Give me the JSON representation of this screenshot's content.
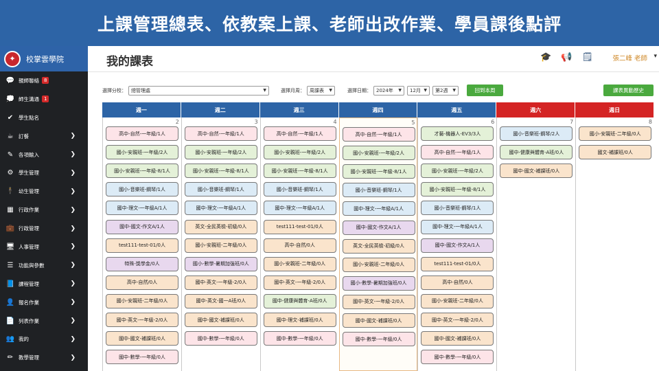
{
  "banner": {
    "title": "上課管理總表、依教案上課、老師出改作業、學員課後點評"
  },
  "brand": {
    "name": "校掌雲學院",
    "logo_icon": "shield-logo-icon"
  },
  "sidebar": {
    "items": [
      {
        "label": "親師聯絡",
        "icon": "chat-icon",
        "glyph": "💬",
        "badge": "8",
        "chevron": false
      },
      {
        "label": "師生溝通",
        "icon": "comment-icon",
        "glyph": "💭",
        "badge": "1",
        "chevron": false
      },
      {
        "label": "學生點名",
        "icon": "check-icon",
        "glyph": "✔",
        "badge": null,
        "chevron": false
      },
      {
        "label": "訂餐",
        "icon": "coffee-icon",
        "glyph": "☕",
        "badge": null,
        "chevron": true
      },
      {
        "label": "各項輸入",
        "icon": "edit-icon",
        "glyph": "✎",
        "badge": null,
        "chevron": true
      },
      {
        "label": "學生管理",
        "icon": "cogs-icon",
        "glyph": "⚙",
        "badge": null,
        "chevron": true
      },
      {
        "label": "幼生管理",
        "icon": "child-icon",
        "glyph": "🕴",
        "badge": null,
        "chevron": true
      },
      {
        "label": "行政作業",
        "icon": "calendar-icon",
        "glyph": "▦",
        "badge": null,
        "chevron": true
      },
      {
        "label": "行政管理",
        "icon": "briefcase-icon",
        "glyph": "💼",
        "badge": null,
        "chevron": true
      },
      {
        "label": "人事管理",
        "icon": "presentation-icon",
        "glyph": "🖥",
        "badge": null,
        "chevron": true
      },
      {
        "label": "功能與參數",
        "icon": "database-icon",
        "glyph": "☰",
        "badge": null,
        "chevron": true
      },
      {
        "label": "課程管理",
        "icon": "book-icon",
        "glyph": "📘",
        "badge": null,
        "chevron": true
      },
      {
        "label": "報名作業",
        "icon": "user-plus-icon",
        "glyph": "👤",
        "badge": null,
        "chevron": true
      },
      {
        "label": "列表作業",
        "icon": "file-icon",
        "glyph": "📄",
        "badge": null,
        "chevron": true
      },
      {
        "label": "我的",
        "icon": "users-icon",
        "glyph": "👥",
        "badge": null,
        "chevron": true
      },
      {
        "label": "教學管理",
        "icon": "pencil-icon",
        "glyph": "✏",
        "badge": null,
        "chevron": true
      }
    ]
  },
  "header": {
    "title": "我的課表",
    "user": "張二峰 老師",
    "icons": [
      "graduation-cap-icon",
      "megaphone-icon",
      "note-icon"
    ]
  },
  "filters": {
    "branch_label": "選擇分校：",
    "branch_value": "總管理處",
    "view_label": "選擇月周：",
    "view_value": "周課表",
    "date_label": "選擇日期：",
    "year_value": "2024年",
    "month_value": "12月",
    "week_value": "第2週",
    "back_button": "回到本周",
    "history_button": "課表異動歷史"
  },
  "colors": {
    "header_blue": "#2d64a6",
    "weekend_red": "#d42424",
    "item_pink": "#fde4e8",
    "item_green": "#e4f1d8",
    "item_blue": "#dcebf6",
    "item_purple": "#e8d8ee",
    "item_peach": "#fae4cc"
  },
  "week": {
    "days": [
      {
        "label": "週一",
        "num": "2",
        "weekend": false,
        "today": false,
        "items": [
          {
            "text": "高中-自然-一年級/1人",
            "color": "pink"
          },
          {
            "text": "國小-安親班-一年級/2人",
            "color": "green"
          },
          {
            "text": "國小-安親班-一年級-8/1人",
            "color": "green"
          },
          {
            "text": "國小-音樂班-鋼琴/1人",
            "color": "blue"
          },
          {
            "text": "國中-理文-一年級A/1人",
            "color": "blue"
          },
          {
            "text": "國中-國文-作文A/1人",
            "color": "purple"
          },
          {
            "text": "test111-test-01/0人",
            "color": "peach"
          },
          {
            "text": "特殊-獎學金/0人",
            "color": "purple"
          },
          {
            "text": "高中-自然/0人",
            "color": "peach"
          },
          {
            "text": "國小-安親班-二年級/0人",
            "color": "peach"
          },
          {
            "text": "國中-英文-一年級-2/0人",
            "color": "peach"
          },
          {
            "text": "國中-國文-補課班/0人",
            "color": "peach"
          },
          {
            "text": "國中-數學-一年級/0人",
            "color": "pink"
          }
        ]
      },
      {
        "label": "週二",
        "num": "3",
        "weekend": false,
        "today": false,
        "items": [
          {
            "text": "高中-自然-一年級/1人",
            "color": "pink"
          },
          {
            "text": "國小-安親班-一年級/2人",
            "color": "green"
          },
          {
            "text": "國小-安親班-一年級-8/1人",
            "color": "green"
          },
          {
            "text": "國小-音樂班-鋼琴/1人",
            "color": "blue"
          },
          {
            "text": "國中-理文-一年級A/1人",
            "color": "blue"
          },
          {
            "text": "英文-全民英檢-初級/0人",
            "color": "peach"
          },
          {
            "text": "國小-安親班-二年級/0人",
            "color": "peach"
          },
          {
            "text": "國小-數學-暑期加強班/0人",
            "color": "purple"
          },
          {
            "text": "國中-英文-一年級-2/0人",
            "color": "peach"
          },
          {
            "text": "國中-英文-國一A班/0人",
            "color": "peach"
          },
          {
            "text": "國中-國文-補課班/0人",
            "color": "peach"
          },
          {
            "text": "國中-數學-一年級/0人",
            "color": "pink"
          }
        ]
      },
      {
        "label": "週三",
        "num": "4",
        "weekend": false,
        "today": false,
        "items": [
          {
            "text": "高中-自然-一年級/1人",
            "color": "pink"
          },
          {
            "text": "國小-安親班-一年級/2人",
            "color": "green"
          },
          {
            "text": "國小-安親班-一年級-8/1人",
            "color": "green"
          },
          {
            "text": "國小-音樂班-鋼琴/1人",
            "color": "blue"
          },
          {
            "text": "國中-理文-一年級A/1人",
            "color": "blue"
          },
          {
            "text": "test111-test-01/0人",
            "color": "peach"
          },
          {
            "text": "高中-自然/0人",
            "color": "peach"
          },
          {
            "text": "國小-安親班-二年級/0人",
            "color": "peach"
          },
          {
            "text": "國中-英文-一年級-2/0人",
            "color": "peach"
          },
          {
            "text": "國中-健康與體育-A班/0人",
            "color": "green"
          },
          {
            "text": "國中-理文-補課班/0人",
            "color": "peach"
          },
          {
            "text": "國中-數學-一年級/0人",
            "color": "pink"
          }
        ]
      },
      {
        "label": "週四",
        "num": "5",
        "weekend": false,
        "today": true,
        "items": [
          {
            "text": "高中-自然-一年級/1人",
            "color": "pink"
          },
          {
            "text": "國小-安親班-一年級/2人",
            "color": "green"
          },
          {
            "text": "國小-安親班-一年級-8/1人",
            "color": "green"
          },
          {
            "text": "國小-音樂班-鋼琴/1人",
            "color": "blue"
          },
          {
            "text": "國中-理文-一年級A/1人",
            "color": "blue"
          },
          {
            "text": "國中-國文-作文A/1人",
            "color": "purple"
          },
          {
            "text": "英文-全民英檢-初級/0人",
            "color": "peach"
          },
          {
            "text": "國小-安親班-二年級/0人",
            "color": "peach"
          },
          {
            "text": "國小-數學-暑期加強班/0人",
            "color": "purple"
          },
          {
            "text": "國中-英文-一年級-2/0人",
            "color": "peach"
          },
          {
            "text": "國中-國文-補課班/0人",
            "color": "peach"
          },
          {
            "text": "國中-數學-一年級/0人",
            "color": "pink"
          }
        ]
      },
      {
        "label": "週五",
        "num": "6",
        "weekend": false,
        "today": false,
        "items": [
          {
            "text": "才藝-機器人-EV3/3人",
            "color": "green"
          },
          {
            "text": "高中-自然-一年級/1人",
            "color": "pink"
          },
          {
            "text": "國小-安親班-一年級/2人",
            "color": "green"
          },
          {
            "text": "國小-安親班-一年級-8/1人",
            "color": "green"
          },
          {
            "text": "國小-音樂班-鋼琴/1人",
            "color": "blue"
          },
          {
            "text": "國中-理文-一年級A/1人",
            "color": "blue"
          },
          {
            "text": "國中-國文-作文A/1人",
            "color": "purple"
          },
          {
            "text": "test111-test-01/0人",
            "color": "peach"
          },
          {
            "text": "高中-自然/0人",
            "color": "peach"
          },
          {
            "text": "國小-安親班-二年級/0人",
            "color": "peach"
          },
          {
            "text": "國中-英文-一年級-2/0人",
            "color": "peach"
          },
          {
            "text": "國中-國文-補課班/0人",
            "color": "peach"
          },
          {
            "text": "國中-數學-一年級/0人",
            "color": "pink"
          }
        ]
      },
      {
        "label": "週六",
        "num": "7",
        "weekend": true,
        "today": false,
        "items": [
          {
            "text": "國小-音樂班-鋼琴/2人",
            "color": "blue"
          },
          {
            "text": "國中-健康與體育-A班/0人",
            "color": "green"
          },
          {
            "text": "國中-國文-補課班/0人",
            "color": "peach"
          }
        ]
      },
      {
        "label": "週日",
        "num": "8",
        "weekend": true,
        "today": false,
        "items": [
          {
            "text": "國小-安親班-二年級/0人",
            "color": "peach"
          },
          {
            "text": "國文-補課班/0人",
            "color": "peach"
          }
        ]
      }
    ]
  }
}
